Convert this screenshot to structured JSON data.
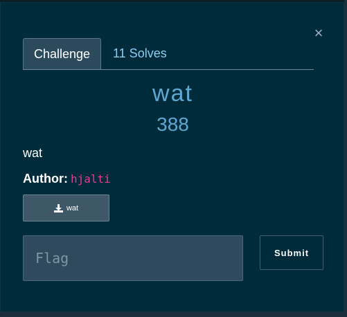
{
  "modal": {
    "close_symbol": "×",
    "tabs": [
      {
        "label": "Challenge",
        "active": true
      },
      {
        "label": "11 Solves",
        "active": false
      }
    ],
    "challenge": {
      "name": "wat",
      "points": "388",
      "description": "wat",
      "author_label": "Author:",
      "author_name": "hjalti"
    },
    "file": {
      "icon": "download-icon",
      "label": "wat"
    },
    "flag_input": {
      "placeholder": "Flag",
      "value": ""
    },
    "submit_label": "Submit"
  },
  "colors": {
    "background": "#002b3b",
    "accent": "#5fa8d3",
    "tab_link": "#8ecdf2",
    "author_code": "#e83e8c"
  }
}
